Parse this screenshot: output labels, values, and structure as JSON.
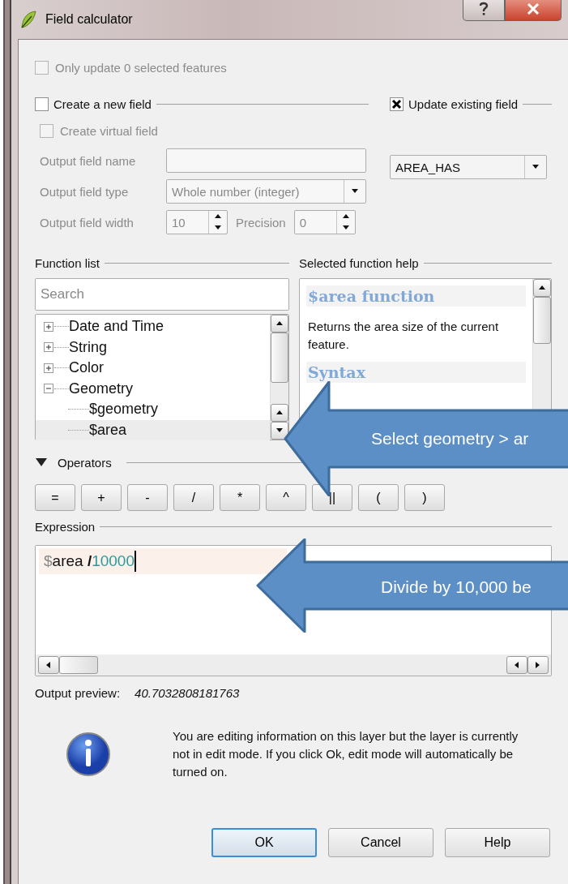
{
  "window": {
    "title": "Field calculator"
  },
  "only_selected": {
    "label": "Only update 0 selected features",
    "checked": false,
    "disabled": true
  },
  "create_new_field": {
    "label": "Create a new field",
    "checked": false
  },
  "update_existing_field": {
    "label": "Update existing field",
    "checked": true
  },
  "create_virtual_field": {
    "label": "Create virtual field",
    "checked": false,
    "disabled": true
  },
  "output_field_name": {
    "label": "Output field name"
  },
  "output_field_type": {
    "label": "Output field type",
    "value": "Whole number (integer)"
  },
  "output_field_width": {
    "label": "Output field width",
    "value": "10"
  },
  "precision": {
    "label": "Precision",
    "value": "0"
  },
  "existing_field": {
    "value": "AREA_HAS"
  },
  "function_list": {
    "title": "Function list",
    "search": {
      "placeholder": "Search"
    },
    "items": [
      {
        "label": "Date and Time",
        "expanded": false
      },
      {
        "label": "String",
        "expanded": false
      },
      {
        "label": "Color",
        "expanded": false
      },
      {
        "label": "Geometry",
        "expanded": true,
        "children": [
          {
            "label": "$geometry",
            "selected": false
          },
          {
            "label": "$area",
            "selected": true
          }
        ]
      }
    ]
  },
  "help": {
    "title": "Selected function help",
    "heading": "$area function",
    "text": "Returns the area size of the current feature.",
    "section": "Syntax"
  },
  "operators": {
    "title": "Operators",
    "expanded": true,
    "buttons": [
      "=",
      "+",
      "-",
      "/",
      "*",
      "^",
      "||",
      "(",
      ")"
    ]
  },
  "expression": {
    "title": "Expression",
    "tokens": [
      {
        "kind": "sigil",
        "text": "$"
      },
      {
        "kind": "field",
        "text": "area "
      },
      {
        "kind": "operator",
        "text": "/"
      },
      {
        "kind": "number",
        "text": "10000"
      }
    ]
  },
  "output_preview": {
    "label": "Output preview:",
    "value": "40.7032808181763"
  },
  "info": {
    "text": "You are editing information on this layer but the layer is currently not in edit mode. If you click Ok, edit mode will automatically be turned on."
  },
  "buttons": [
    {
      "label": "OK",
      "default": true
    },
    {
      "label": "Cancel",
      "default": false
    },
    {
      "label": "Help",
      "default": false
    }
  ],
  "callouts": [
    {
      "text": "Select geometry > ar"
    },
    {
      "text": "Divide by 10,000 be"
    }
  ]
}
